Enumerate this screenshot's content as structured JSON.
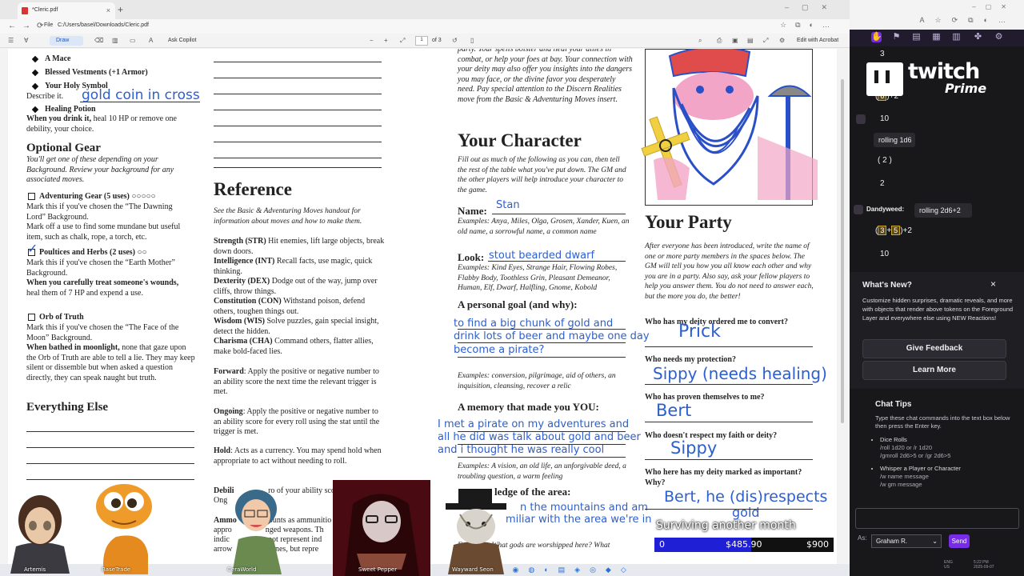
{
  "browser": {
    "tab_title": "*Cleric.pdf",
    "addr_label": "File",
    "address": "C:/Users/basel/Downloads/Cleric.pdf",
    "draw_label": "Draw",
    "ask_copilot": "Ask Copilot",
    "page_current": "1",
    "page_total": "of 3",
    "edit_acrobat": "Edit with Acrobat"
  },
  "pdf": {
    "col1": {
      "items": [
        "A Mace",
        "Blessed Vestments (+1 Armor)",
        "Your Holy Symbol"
      ],
      "describe": "Describe it.",
      "healing_potion": "Healing Potion",
      "healing_lead": "When you drink it,",
      "healing_text": "heal 10 HP or remove one debility, your choice.",
      "optional_heading": "Optional Gear",
      "optional_desc": "You'll get one of these depending on your Background. Review your background for any associated moves.",
      "adv_title": "Adventuring Gear (5 uses)",
      "adv_text": "Mark this if you've chosen the “The Dawning Lord” Background.",
      "adv_text2": "Mark off a use to find some mundane but useful item, such as chalk, rope, a torch, etc.",
      "poul_title": "Poultices and Herbs (2 uses)",
      "poul_text": "Mark this if you've chosen the “Earth Mother” Background.",
      "poul_lead": "When you carefully treat someone's wounds,",
      "poul_rest": "heal them of 7 HP and expend a use.",
      "orb_title": "Orb of Truth",
      "orb_text": "Mark this if you've chosen the “The Face of the Moon” Background.",
      "orb_lead": "When bathed in moonlight,",
      "orb_rest": "none that gaze upon the Orb of Truth are able to tell a lie. They may keep silent or dissemble but when asked a question directly, they can speak naught but truth.",
      "else_heading": "Everything Else"
    },
    "col2": {
      "reference_heading": "Reference",
      "reference_desc": "See the Basic & Adventuring Moves handout for information about moves and how to make them.",
      "stats": [
        {
          "name": "Strength (STR)",
          "desc": "Hit enemies, lift large objects, break down doors."
        },
        {
          "name": "Intelligence (INT)",
          "desc": "Recall facts, use magic, quick thinking."
        },
        {
          "name": "Dexterity (DEX)",
          "desc": "Dodge out of the way, jump over cliffs, throw things."
        },
        {
          "name": "Constitution (CON)",
          "desc": "Withstand poison, defend others, toughen things out."
        },
        {
          "name": "Wisdom (WIS)",
          "desc": "Solve puzzles, gain special insight, detect the hidden."
        },
        {
          "name": "Charisma (CHA)",
          "desc": "Command others, flatter allies, make bold-faced lies."
        }
      ],
      "forward_name": "Forward",
      "forward_desc": ": Apply the positive or negative number to an ability score the next time the relevant trigger is met.",
      "ongoing_name": "Ongoing",
      "ongoing_desc": ": Apply the positive or negative number to an ability score for every roll using the stat until the trigger is met.",
      "hold_name": "Hold",
      "hold_desc": ": Acts as a currency. You may spend hold when appropriate to act without needing to roll.",
      "debility_name": "Debili",
      "debility_desc": "ro of your ability sco",
      "debility_line2": "Ong",
      "ammo_name": "Ammo",
      "ammo_desc": "ounts as ammunitio",
      "ammo_l2": "appro",
      "ammo_l2b": "nged weapons. Th",
      "ammo_l3": "indic",
      "ammo_l3b": "not represent ind",
      "ammo_l4": "arrow",
      "ammo_l4b": "stones, but repre"
    },
    "col3": {
      "intro": "party. Your spells bolster and heal your allies in combat, or help your foes at bay. Your connection with your deity may also offer you insights into the dangers you may face, or the divine favor you desperately need. Pay special attention to the Discern Realities move from the Basic & Adventuring Moves insert.",
      "your_character": "Your Character",
      "yc_desc": "Fill out as much of the following as you can, then tell the rest of the table what you've put down. The GM and the other players will help introduce your character to the game.",
      "name_label": "Name:",
      "name_value": "Stan",
      "name_examples": "Examples: Anya, Miles, Olga, Grosen, Xander, Kuen, an old name, a sorrowful name, a common name",
      "look_label": "Look:",
      "look_value": "stout bearded dwarf",
      "look_examples": "Examples: Kind Eyes, Strange Hair, Flowing Robes, Flabby Body, Toothless Grin, Pleasant Demeanor, Human, Elf, Dwarf, Halfling, Gnome, Kobold",
      "goal_label": "A personal goal (and why):",
      "goal_value_1": "to find a big chunk of gold and",
      "goal_value_2": "drink lots of beer and maybe one day",
      "goal_value_3": "become a pirate?",
      "goal_examples": "Examples: conversion, pilgrimage, aid of others, an inquisition, cleansing, recover a relic",
      "memory_label": "A memory that made you YOU:",
      "memory_value_1": "I met a pirate on my adventures and",
      "memory_value_2": "all he did was talk about gold and beer",
      "memory_value_3": "and i thought he was really cool",
      "memory_examples": "Examples: A vision, an old life, an unforgivable deed, a troubling question, a warm feeling",
      "knowledge_label": "ledge of the area:",
      "knowledge_value_1": "n the mountains and am",
      "knowledge_value_2": "miliar with the area we're in",
      "knowledge_examples": "les: What gods are worshipped here? What"
    },
    "col4": {
      "your_party": "Your Party",
      "party_desc": "After everyone has been introduced, write the name of one or more party members in the spaces below. The GM will tell you how you all know each other and why you are in a party. Also say, ask your fellow players to help you answer them. You do not need to answer each, but the more you do, the better!",
      "q1": "Who has my deity ordered me to convert?",
      "a1": "Prick",
      "q2": "Who needs my protection?",
      "a2": "Sippy (needs healing)",
      "q3": "Who has proven themselves to me?",
      "a3": "Bert",
      "q4": "Who doesn't respect my faith or deity?",
      "a4": "Sippy",
      "q5": "Who here has my deity marked as important? Why?",
      "a5": "Bert, he (dis)respects",
      "a5b": "gold"
    },
    "handwriting": {
      "gold_coin": "gold coin in cross"
    }
  },
  "overlay": {
    "twitch": "twitch",
    "prime": "Prime",
    "goal_title": "Surviving another month",
    "goal_start": "0",
    "goal_current": "$485.90",
    "goal_target": "$900",
    "goal_progress": 0.54,
    "characters": [
      "Artemis",
      "BaseTrade",
      "CeraWorld",
      "Sweet Pepper",
      "Wayward Seon"
    ]
  },
  "sidebar": {
    "chat": {
      "l1": "3",
      "l2_total": "+2",
      "l2_die": "6",
      "l3": "10",
      "l4": "rolling 1d6",
      "l5_die": "2",
      "l6": "2",
      "user": "Dandyweed:",
      "user_msg": "rolling 2d6+2",
      "l7_d1": "3",
      "l7_d2": "5",
      "l7_rest": "+2",
      "l8": "10"
    },
    "whatsnew": {
      "title": "What's New?",
      "close": "×",
      "desc": "Customize hidden surprises, dramatic reveals, and more with objects that render above tokens on the Foreground Layer and everywhere else using NEW Reactions!",
      "feedback": "Give Feedback",
      "learn": "Learn More"
    },
    "tips": {
      "title": "Chat Tips",
      "sub": "Type these chat commands into the text box below then press the Enter key.",
      "dice_title": "Dice Rolls",
      "dice_cmds": "/roll 1d20 or /r 1d20",
      "dice_cmds2": "/gmroll 2d6>5 or /gr 2d6>5",
      "whisper_title": "Whisper a Player or Character",
      "whisper_cmd": "/w name message",
      "whisper_cmd2": "/w gm message"
    },
    "as_label": "As:",
    "as_value": "Graham R.",
    "send": "Send"
  },
  "tray": {
    "lang1": "ENG",
    "lang2": "US",
    "time": "5:22 PM",
    "date": "2025-09-07"
  }
}
